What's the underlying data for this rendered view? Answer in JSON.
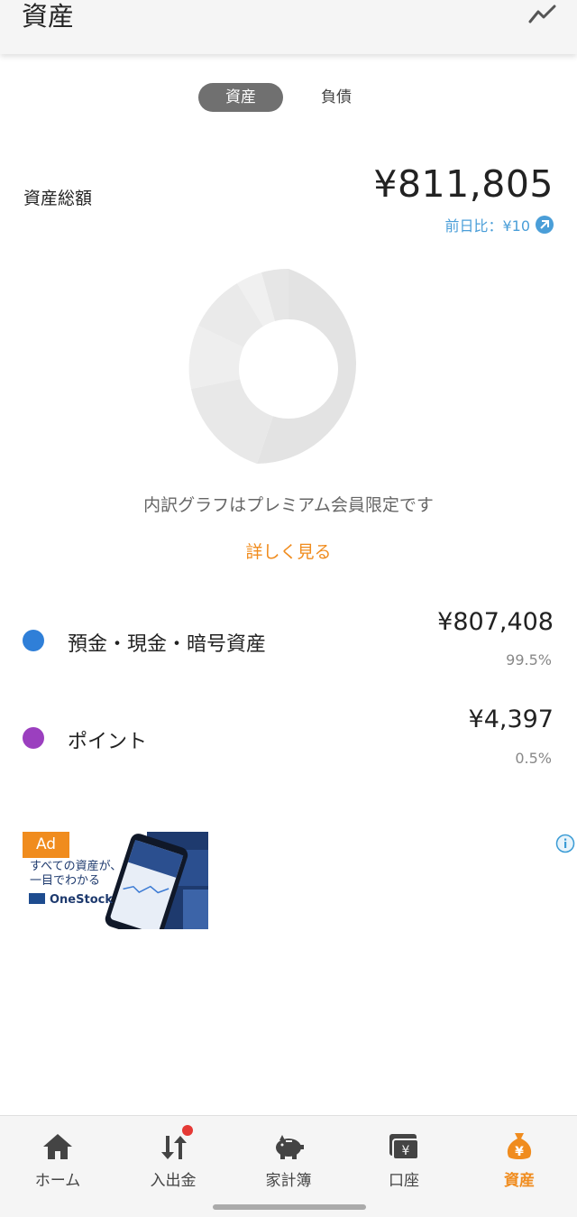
{
  "header": {
    "title": "資産",
    "trend_icon": "trend-line-icon"
  },
  "segmented": {
    "assets_label": "資産",
    "liabilities_label": "負債",
    "selected": "資産"
  },
  "summary": {
    "label": "資産総額",
    "total": "¥811,805",
    "diff": "前日比：¥10",
    "diff_icon": "arrow-up-right-circle-icon"
  },
  "breakdown": {
    "note": "内訳グラフはプレミアム会員限定です",
    "link": "詳しく見る"
  },
  "categories": [
    {
      "name": "預金・現金・暗号資産",
      "amount": "¥807,408",
      "percent": "99.5%",
      "color": "#2f7fd8"
    },
    {
      "name": "ポイント",
      "amount": "¥4,397",
      "percent": "0.5%",
      "color": "#9b3fbf"
    }
  ],
  "ad": {
    "badge": "Ad",
    "line1": "すべての資産が、",
    "line2": "一目でわかる",
    "brand": "OneStock",
    "info_icon": "info-icon"
  },
  "nav": {
    "items": [
      {
        "label": "ホーム",
        "icon": "home-icon"
      },
      {
        "label": "入出金",
        "icon": "transfer-arrows-icon"
      },
      {
        "label": "家計簿",
        "icon": "piggy-bank-icon"
      },
      {
        "label": "口座",
        "icon": "wallet-yen-icon"
      },
      {
        "label": "資産",
        "icon": "money-bag-icon"
      }
    ],
    "active": "資産"
  },
  "colors": {
    "accent": "#f08c1e",
    "link_blue": "#4a9ed8"
  }
}
